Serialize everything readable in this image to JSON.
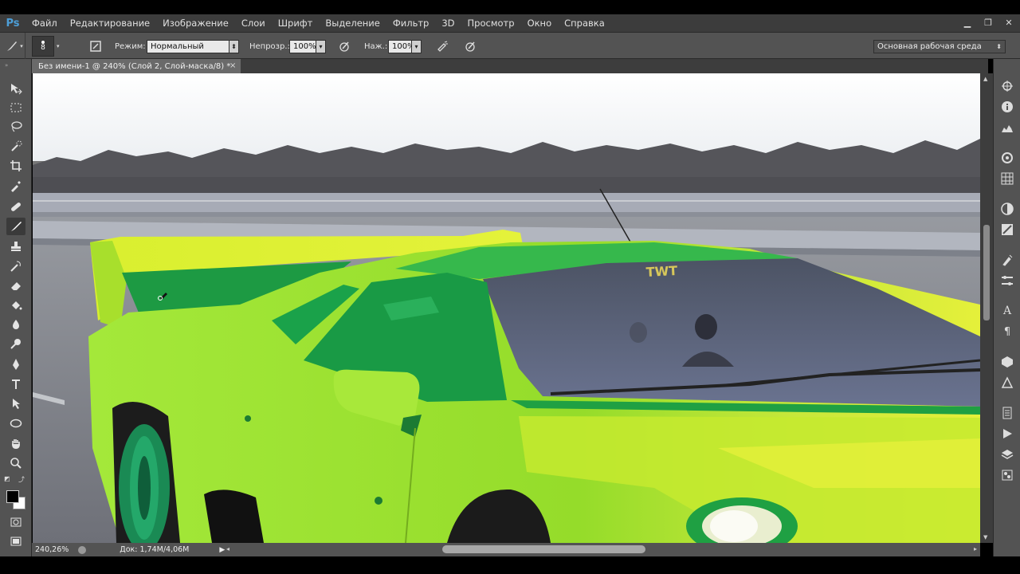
{
  "app": {
    "logo": "Ps",
    "menu": [
      "Файл",
      "Редактирование",
      "Изображение",
      "Слои",
      "Шрифт",
      "Выделение",
      "Фильтр",
      "3D",
      "Просмотр",
      "Окно",
      "Справка"
    ]
  },
  "window_controls": [
    "minimize-icon",
    "restore-icon",
    "close-icon"
  ],
  "options_bar": {
    "brush_size": "8",
    "mode_label": "Режим:",
    "mode_value": "Нормальный",
    "opacity_label": "Непрозр.:",
    "opacity_value": "100%",
    "flow_label": "Наж.:",
    "flow_value": "100%",
    "workspace": "Основная рабочая среда"
  },
  "document": {
    "tab_title": "Без имени-1 @ 240% (Слой 2, Слой-маска/8) *",
    "close": "×"
  },
  "status": {
    "zoom": "240,26%",
    "doc_info": "Док: 1,74M/4,06M"
  },
  "toolbox": {
    "tools": [
      "move-tool",
      "marquee-tool",
      "lasso-tool",
      "quick-select-tool",
      "crop-tool",
      "eyedropper-tool",
      "healing-brush-tool",
      "brush-tool",
      "clone-stamp-tool",
      "history-brush-tool",
      "eraser-tool",
      "paint-bucket-tool",
      "blur-tool",
      "dodge-tool",
      "pen-tool",
      "type-tool",
      "path-select-tool",
      "ellipse-tool",
      "hand-tool",
      "zoom-tool"
    ],
    "active_tool": "brush-tool",
    "foreground_color": "#000000",
    "background_color": "#ffffff"
  },
  "colors": {
    "car_body": "#9ee52e",
    "car_green_tint": "#1fa043",
    "ui_panel": "#535353",
    "menubar": "#3c3c3c"
  }
}
